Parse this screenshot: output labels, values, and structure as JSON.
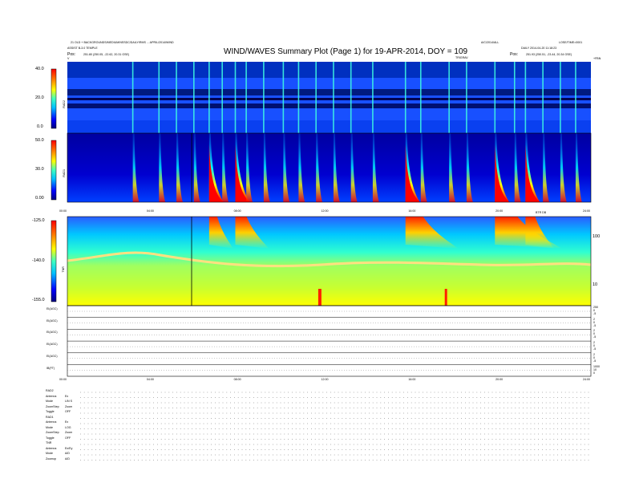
{
  "header": {
    "title": "WIND/WAVES Summary Plot (Page 1) for 19-APR-2014, DOY = 109",
    "left_line1": "21 OLD + BACKGROUNDS/MEDIUM/NSSDC/DAILY/RMS ... APRIL/2014/WIND",
    "left_line2": "ASSIST B-3.0 TEMPLE",
    "left_pos_label": "Pos:",
    "left_pos_value": "251.80 (250.05, -22.62, 20.31 GSE)",
    "right_top_mid": "A/C/2014/ALL",
    "right_top_right": "LOSE/TIME=0001",
    "right_line2": "DAILY 2014-04-20 11:18:23",
    "right_pos_label": "Pos:",
    "right_pos_value": "251.93 (250.51, -23.44, 20.34 GSE)",
    "arrow_label": "TRIGRAV",
    "corner_left": "V",
    "corner_right": "+FBN"
  },
  "panels": {
    "rad2": {
      "name": "RAD2",
      "ticks": [
        "40.0",
        "20.0",
        "0.0"
      ]
    },
    "rad1": {
      "name": "RAD1",
      "ticks": [
        "50.0",
        "30.0",
        "0.00"
      ]
    },
    "tnr": {
      "name": "TNR",
      "ticks": [
        "-125.0",
        "-140.0",
        "-155.0"
      ],
      "right_label": "BTR DB",
      "right_ticks": [
        "100",
        "10"
      ]
    }
  },
  "time_axis": [
    "00:00",
    "04:00",
    "08:00",
    "12:00",
    "16:00",
    "20:00",
    "24:00"
  ],
  "strip_labels": [
    "EI(AGC)",
    "EI(AGC)",
    "EI(AGC)",
    "EI(AGC)",
    "EI(AGC)",
    "IB(FT)"
  ],
  "strip_right": [
    [
      "250",
      "0",
      "-5"
    ],
    [
      "2",
      "0",
      "-5"
    ],
    [
      "2",
      "0",
      "-5"
    ],
    [
      "2",
      "0",
      "-5"
    ],
    [
      "2",
      "0",
      "-5"
    ],
    [
      "1000",
      "10",
      "0"
    ]
  ],
  "footer": {
    "group1_title": "RAD2",
    "group1_rows": [
      [
        "Antenna",
        "Ex"
      ],
      [
        "Mode",
        "LIN S"
      ],
      [
        "ZoomStep",
        "Zoom"
      ],
      [
        "Toggle",
        "OFF"
      ]
    ],
    "group2_title": "RAD1",
    "group2_rows": [
      [
        "Antenna",
        "Ex"
      ],
      [
        "Mode",
        "LOG"
      ],
      [
        "ZoomStep",
        "Zoom"
      ],
      [
        "Toggle",
        "OFF"
      ]
    ],
    "group3_title": "TNR",
    "group3_rows": [
      [
        "Antenna",
        "Ex/Ey"
      ],
      [
        "Mode",
        "A/D"
      ],
      [
        "Zoomop",
        "A/D"
      ]
    ]
  },
  "chart_data": {
    "type": "heatmap",
    "title": "WIND/WAVES Summary Plot (Page 1) for 19-APR-2014, DOY = 109",
    "x_range_hours": [
      0,
      24
    ],
    "x_ticks": [
      "00:00",
      "04:00",
      "08:00",
      "12:00",
      "16:00",
      "20:00",
      "24:00"
    ],
    "colormap": [
      "#00007f",
      "#0000ff",
      "#00a0ff",
      "#00ffff",
      "#7fff7f",
      "#ffff00",
      "#ff8000",
      "#ff0000",
      "#7f0000"
    ],
    "panels": [
      {
        "name": "RAD2",
        "ylim": [
          0,
          40
        ]
      },
      {
        "name": "RAD1",
        "ylim": [
          0,
          50
        ]
      },
      {
        "name": "TNR",
        "ylim": [
          -155,
          -125
        ]
      }
    ],
    "type_iii_bursts_hours": [
      3.0,
      4.2,
      5.0,
      5.8,
      6.5,
      7.1,
      7.7,
      8.2,
      9.0,
      9.9,
      10.6,
      11.4,
      12.2,
      13.0,
      14.0,
      15.5,
      16.2,
      17.5,
      18.3,
      19.6,
      20.5,
      21.0,
      21.8,
      22.6,
      23.3
    ]
  }
}
